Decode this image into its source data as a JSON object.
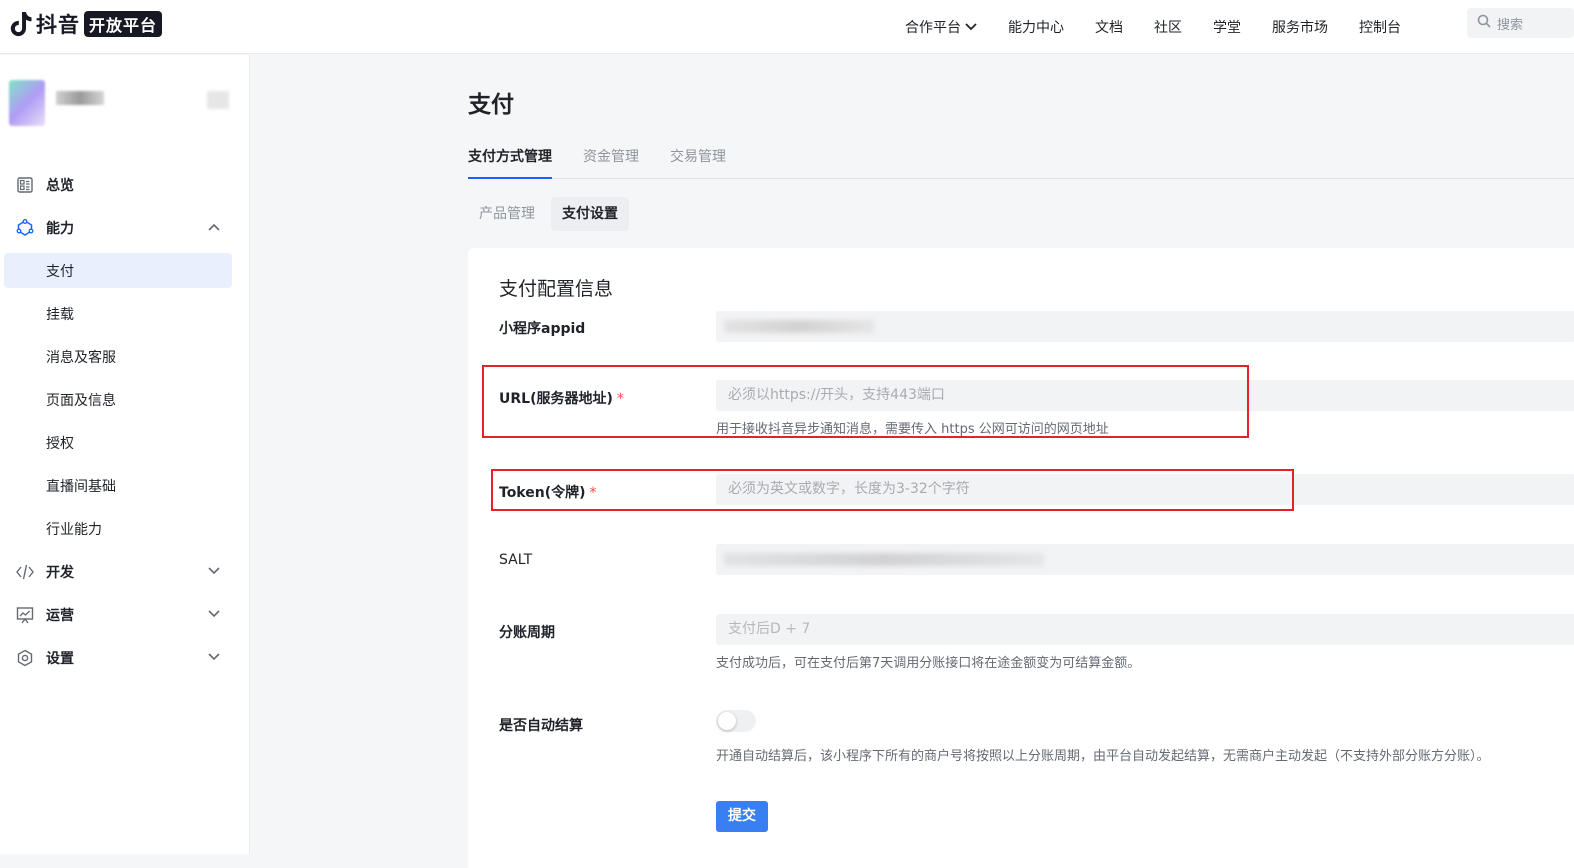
{
  "topbar": {
    "logo_text": "抖音",
    "logo_badge": "开放平台",
    "nav": [
      {
        "label": "合作平台",
        "has_dropdown": true
      },
      {
        "label": "能力中心"
      },
      {
        "label": "文档"
      },
      {
        "label": "社区"
      },
      {
        "label": "学堂"
      },
      {
        "label": "服务市场"
      },
      {
        "label": "控制台"
      }
    ],
    "search_placeholder": "搜索"
  },
  "sidebar": {
    "groups": [
      {
        "label": "总览",
        "icon": "dashboard-icon"
      },
      {
        "label": "能力",
        "icon": "capability-icon",
        "expanded": true,
        "items": [
          "支付",
          "挂载",
          "消息及客服",
          "页面及信息",
          "授权",
          "直播间基础",
          "行业能力"
        ],
        "active_item": "支付"
      },
      {
        "label": "开发",
        "icon": "code-icon",
        "expanded": false
      },
      {
        "label": "运营",
        "icon": "operations-icon",
        "expanded": false
      },
      {
        "label": "设置",
        "icon": "settings-icon",
        "expanded": false
      }
    ]
  },
  "main": {
    "page_title": "支付",
    "tabs": [
      "支付方式管理",
      "资金管理",
      "交易管理"
    ],
    "active_tab": "支付方式管理",
    "subtabs": [
      "产品管理",
      "支付设置"
    ],
    "active_subtab": "支付设置",
    "card_title": "支付配置信息",
    "form": {
      "appid_label": "小程序appid",
      "url_label": "URL(服务器地址)",
      "url_placeholder": "必须以https://开头，支持443端口",
      "url_hint": "用于接收抖音异步通知消息，需要传入 https 公网可访问的网页地址",
      "token_label": "Token(令牌)",
      "token_placeholder": "必须为英文或数字，长度为3-32个字符",
      "salt_label": "SALT",
      "cycle_label": "分账周期",
      "cycle_value": "支付后D + 7",
      "cycle_hint": "支付成功后，可在支付后第7天调用分账接口将在途金额变为可结算金额。",
      "auto_settle_label": "是否自动结算",
      "auto_settle_on": false,
      "auto_settle_hint": "开通自动结算后，该小程序下所有的商户号将按照以上分账周期，由平台自动发起结算，无需商户主动发起（不支持外部分账方分账）。",
      "required_mark": "*",
      "submit_label": "提交"
    }
  },
  "colors": {
    "accent": "#1664ff",
    "submit": "#3a7ff2",
    "highlight_box": "#e8202a",
    "required": "#f54a45"
  }
}
